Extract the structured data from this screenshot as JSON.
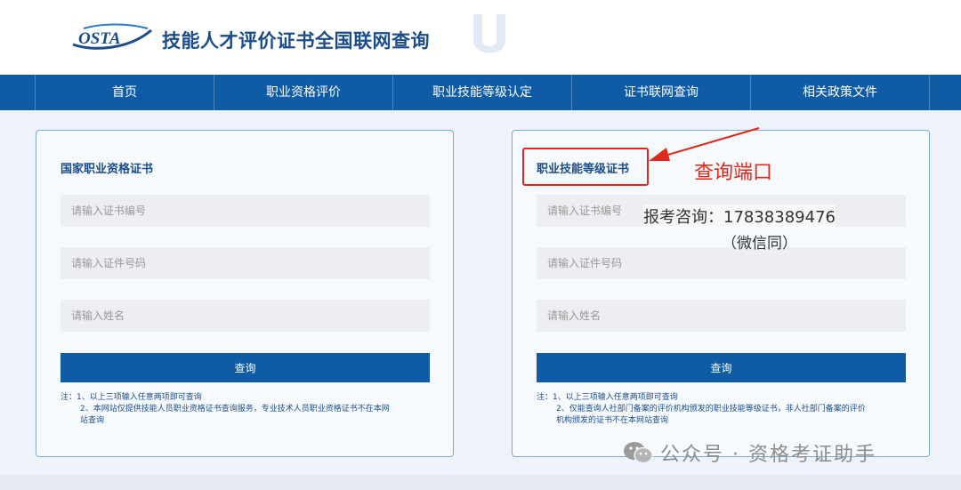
{
  "header": {
    "logo_text": "OSTA",
    "site_title": "技能人才评价证书全国联网查询"
  },
  "nav": {
    "items": [
      "首页",
      "职业资格评价",
      "职业技能等级认定",
      "证书联网查询",
      "相关政策文件"
    ]
  },
  "left_panel": {
    "title": "国家职业资格证书",
    "cert_no_placeholder": "请输入证书编号",
    "id_no_placeholder": "请输入证件号码",
    "name_placeholder": "请输入姓名",
    "query_label": "查询",
    "notes": [
      "注：1、以上三项输入任意两项即可查询",
      "2、本网站仅提供技能人员职业资格证书查询服务，专业技术人员职业资格证书不在本网",
      "站查询"
    ]
  },
  "right_panel": {
    "title": "职业技能等级证书",
    "cert_no_placeholder": "请输入证书编号",
    "id_no_placeholder": "请输入证件号码",
    "name_placeholder": "请输入姓名",
    "query_label": "查询",
    "notes": [
      "注：1、以上三项输入任意两项即可查询",
      "2、仅能查询人社部门备案的评价机构颁发的职业技能等级证书，非人社部门备案的评价",
      "机构颁发的证书不在本网站查询"
    ]
  },
  "annotations": {
    "query_port_label": "查询端口",
    "contact_line": "报考咨询：17838389476",
    "contact_note": "（微信同）",
    "footer_watermark": "公众号 · 资格考证助手",
    "accent_color": "#e0271b"
  },
  "colors": {
    "nav_bg": "#0f5ba6",
    "title_blue": "#1b4c8c",
    "panel_border": "#7aa8d8"
  }
}
